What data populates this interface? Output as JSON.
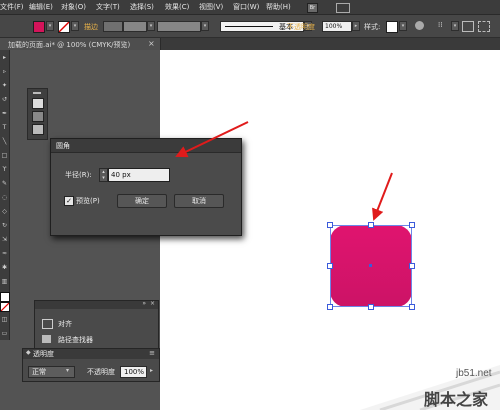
{
  "menubar": {
    "items": [
      "文件(F)",
      "编辑(E)",
      "对象(O)",
      "文字(T)",
      "选择(S)",
      "效果(C)",
      "视图(V)",
      "窗口(W)",
      "帮助(H)"
    ]
  },
  "controlbar": {
    "fill_color": "#d4145a",
    "stroke_label": "描边",
    "stroke_style_label": "基本",
    "opacity_label": "不透明度",
    "opacity_value": "100%",
    "style_label": "样式:"
  },
  "document_tab": "加载的页面.ai* @ 100% (CMYK/预览)",
  "dialog": {
    "title": "圆角",
    "radius_label": "半径(R):",
    "radius_value": "40 px",
    "preview_label": "预览(P)",
    "ok_label": "确定",
    "cancel_label": "取消"
  },
  "shape_fill": "#d4145a",
  "align_panel": {
    "align_label": "对齐",
    "pathfinder_label": "路径查找器"
  },
  "transparency_panel": {
    "title": "透明度",
    "mode_value": "正常",
    "opacity_label": "不透明度",
    "opacity_value": "100%"
  },
  "watermark": {
    "url": "jb51.net",
    "site": "脚本之家"
  }
}
